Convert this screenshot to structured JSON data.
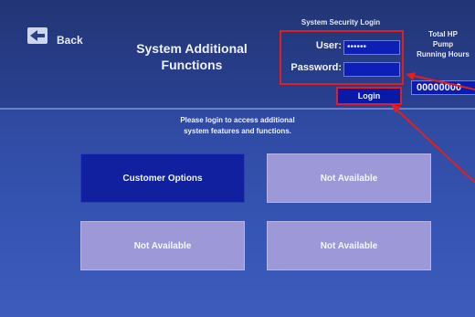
{
  "header": {
    "back_label": "Back",
    "title_line1": "System Additional",
    "title_line2": "Functions"
  },
  "security": {
    "title": "System Security Login",
    "user_label": "User:",
    "user_value": "••••••",
    "password_label": "Password:",
    "password_value": "",
    "login_label": "Login"
  },
  "hours": {
    "line1": "Total HP",
    "line2": "Pump",
    "line3": "Running Hours",
    "value": "00000000"
  },
  "instructions": {
    "line1": "Please login to access additional",
    "line2": "system features and functions."
  },
  "tiles": [
    {
      "label": "Customer Options"
    },
    {
      "label": "Not Available"
    },
    {
      "label": "Not Available"
    },
    {
      "label": "Not Available"
    }
  ],
  "colors": {
    "accent_red": "#e02020",
    "active_tile": "#10209e",
    "disabled_tile": "#9d98d8",
    "input_blue": "#0d1fb5"
  }
}
